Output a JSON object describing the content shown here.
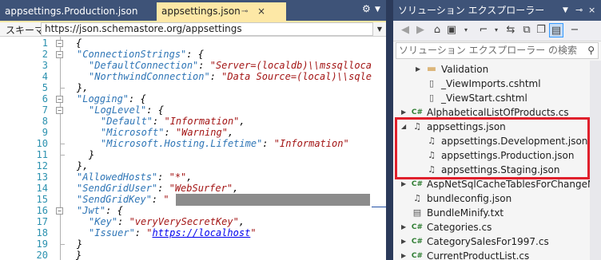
{
  "editor": {
    "tabs": [
      {
        "label": "appsettings.Production.json",
        "active": false
      },
      {
        "label": "appsettings.json",
        "active": true
      }
    ],
    "tab_pin_glyph": "⊸",
    "tab_close_glyph": "×",
    "schema_label": "スキーマ:",
    "schema_url": "https://json.schemastore.org/appsettings",
    "line_numbers": [
      "1",
      "2",
      "3",
      "4",
      "5",
      "6",
      "7",
      "8",
      "9",
      "10",
      "11",
      "12",
      "13",
      "14",
      "15",
      "16",
      "17",
      "18",
      "19",
      "20"
    ],
    "code": {
      "l1": "{",
      "l2_key": "\"ConnectionStrings\"",
      "l2_rest": ": {",
      "l3_key": "\"DefaultConnection\"",
      "l3_val": "\"Server=(localdb)\\\\mssqlloca",
      "l4_key": "\"NorthwindConnection\"",
      "l4_val": "\"Data Source=(local)\\\\sqle",
      "l5": "},",
      "l6_key": "\"Logging\"",
      "l6_rest": ": {",
      "l7_key": "\"LogLevel\"",
      "l7_rest": ": {",
      "l8_key": "\"Default\"",
      "l8_val": "\"Information\"",
      "l9_key": "\"Microsoft\"",
      "l9_val": "\"Warning\"",
      "l10_key": "\"Microsoft.Hosting.Lifetime\"",
      "l10_val": "\"Information\"",
      "l11": "}",
      "l12": "},",
      "l13_key": "\"AllowedHosts\"",
      "l13_val": "\"*\"",
      "l14_key": "\"SendGridUser\"",
      "l14_val": "\"WebSurfer\"",
      "l15_key": "\"SendGridKey\"",
      "l15_val": "\"",
      "l16_key": "\"Jwt\"",
      "l16_rest": ": {",
      "l17_key": "\"Key\"",
      "l17_val": "\"veryVerySecretKey\"",
      "l18_key": "\"Issuer\"",
      "l18_q1": "\"",
      "l18_url": "https://localhost",
      "l18_q2": "\"",
      "l19": "}",
      "l20": "}"
    }
  },
  "solution_explorer": {
    "title": "ソリューション エクスプローラー",
    "search_placeholder": "ソリューション エクスプローラー の検索 (Ctrl+;)",
    "items": [
      {
        "label": "Validation",
        "icon": "folder-icon",
        "expander": "▶"
      },
      {
        "label": "_ViewImports.cshtml",
        "icon": "cshtml-file-icon",
        "expander": ""
      },
      {
        "label": "_ViewStart.cshtml",
        "icon": "cshtml-file-icon",
        "expander": ""
      },
      {
        "label": "AlphabeticalListOfProducts.cs",
        "icon": "csharp-file-icon",
        "expander": "▶"
      },
      {
        "label": "appsettings.json",
        "icon": "json-file-icon",
        "expander": "◢"
      },
      {
        "label": "appsettings.Development.json",
        "icon": "json-file-icon",
        "expander": ""
      },
      {
        "label": "appsettings.Production.json",
        "icon": "json-file-icon",
        "expander": ""
      },
      {
        "label": "appsettings.Staging.json",
        "icon": "json-file-icon",
        "expander": ""
      },
      {
        "label": "AspNetSqlCacheTablesForChangeNc",
        "icon": "csharp-file-icon",
        "expander": "▶"
      },
      {
        "label": "bundleconfig.json",
        "icon": "json-file-icon",
        "expander": ""
      },
      {
        "label": "BundleMinify.txt",
        "icon": "text-file-icon",
        "expander": ""
      },
      {
        "label": "Categories.cs",
        "icon": "csharp-file-icon",
        "expander": "▶"
      },
      {
        "label": "CategorySalesFor1997.cs",
        "icon": "csharp-file-icon",
        "expander": "▶"
      },
      {
        "label": "CurrentProductList.cs",
        "icon": "csharp-file-icon",
        "expander": "▶"
      }
    ],
    "highlight_color": "#e0202c"
  },
  "colors": {
    "title_bar": "#3e5378",
    "active_tab": "#fde8a6",
    "json_key": "#2e75b6",
    "json_string": "#a31515",
    "line_number": "#2b91af"
  }
}
